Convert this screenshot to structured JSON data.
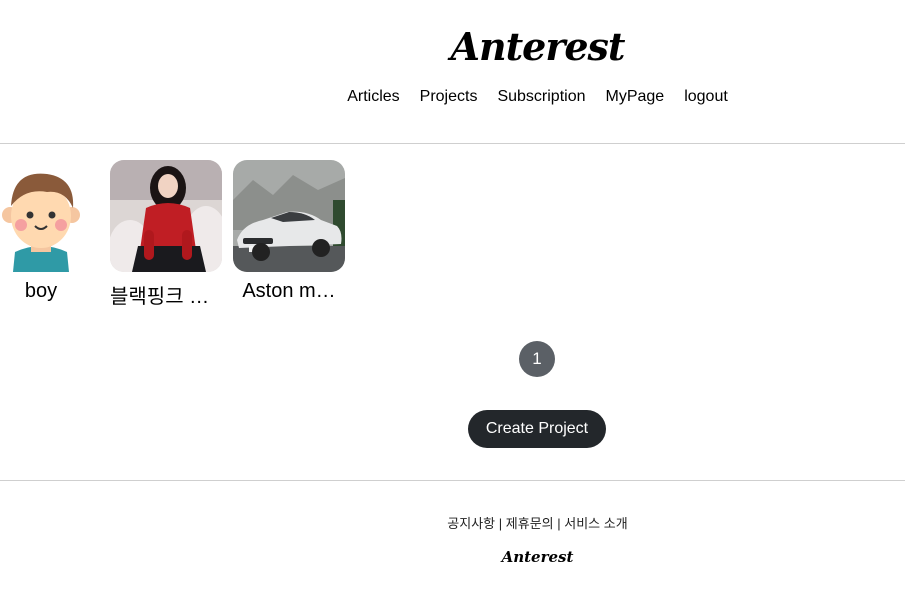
{
  "header": {
    "logo": "Anterest",
    "nav": {
      "articles": "Articles",
      "projects": "Projects",
      "subscription": "Subscription",
      "mypage": "MyPage",
      "logout": "logout"
    }
  },
  "projects": [
    {
      "title": "boy",
      "thumbnail": "boy-avatar-icon"
    },
    {
      "title": "블랙핑크 지수",
      "thumbnail": "photo-woman-red-dress"
    },
    {
      "title": "Aston m…",
      "thumbnail": "photo-white-car"
    }
  ],
  "pagination": {
    "current": "1"
  },
  "create_button": "Create Project",
  "footer": {
    "links": [
      "공지사항",
      "제휴문의",
      "서비스 소개"
    ],
    "separator": "|",
    "logo": "Anterest"
  },
  "colors": {
    "page_button": "#5b6066",
    "create_button": "#23272b",
    "divider": "#cfcfcf"
  }
}
